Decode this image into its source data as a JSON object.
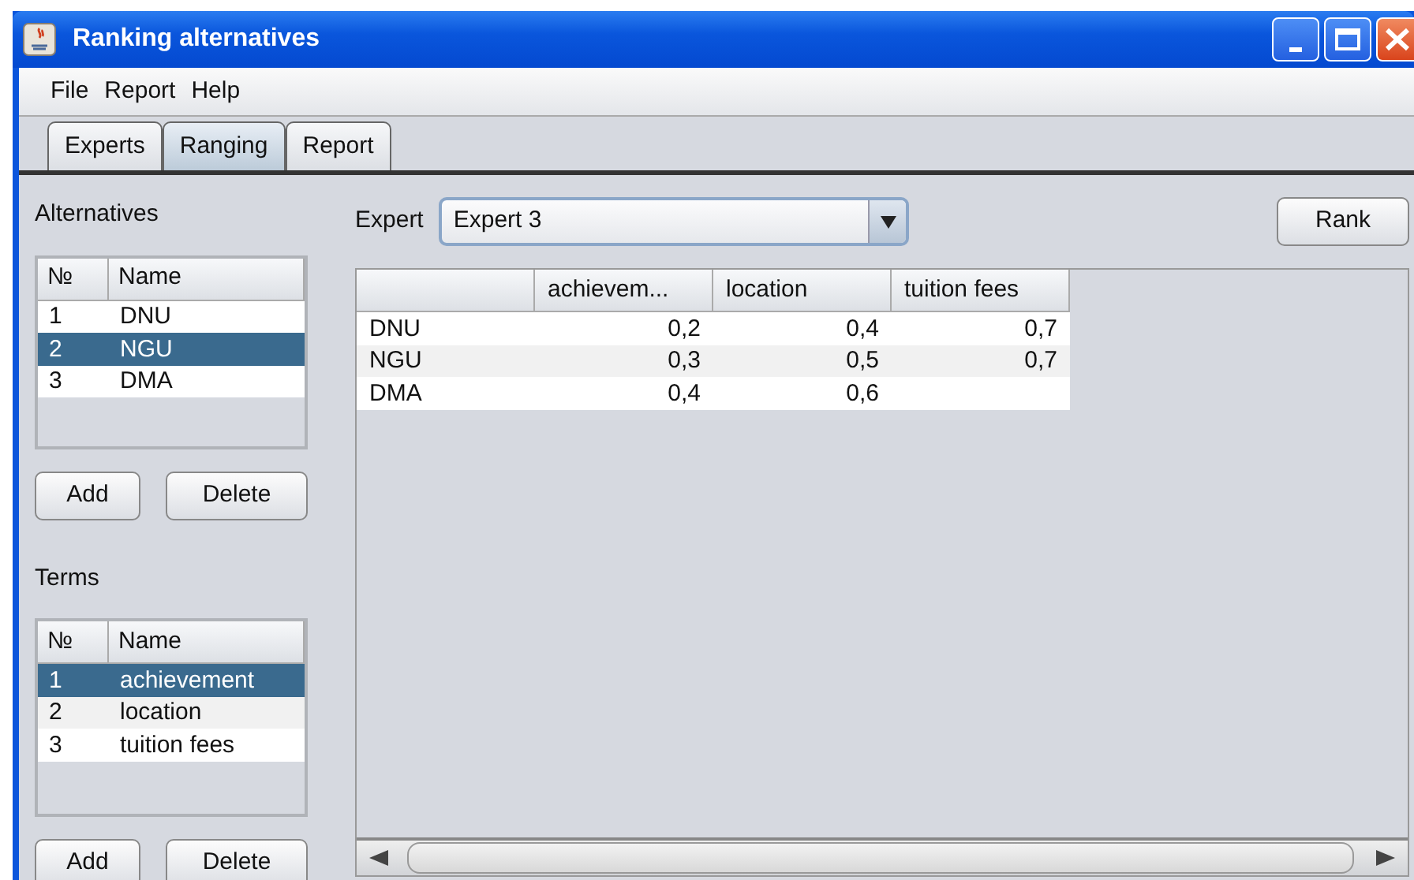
{
  "window": {
    "title": "Ranking alternatives"
  },
  "menu": [
    "File",
    "Report",
    "Help"
  ],
  "tabs": [
    {
      "label": "Experts",
      "selected": false
    },
    {
      "label": "Ranging",
      "selected": true
    },
    {
      "label": "Report",
      "selected": false
    }
  ],
  "alternatives": {
    "label": "Alternatives",
    "columns": [
      "№",
      "Name"
    ],
    "rows": [
      {
        "number": "1",
        "name": "DNU",
        "selected": false
      },
      {
        "number": "2",
        "name": "NGU",
        "selected": true
      },
      {
        "number": "3",
        "name": "DMA",
        "selected": false
      }
    ],
    "buttons": [
      "Add",
      "Delete"
    ]
  },
  "terms": {
    "label": "Terms",
    "columns": [
      "№",
      "Name"
    ],
    "rows": [
      {
        "number": "1",
        "name": "achievement",
        "selected": true
      },
      {
        "number": "2",
        "name": "location",
        "selected": false
      },
      {
        "number": "3",
        "name": "tuition fees",
        "selected": false
      }
    ],
    "buttons": [
      "Add",
      "Delete"
    ]
  },
  "expert": {
    "label": "Expert",
    "value": "Expert 3"
  },
  "rank_button": "Rank",
  "matrix": {
    "columns": [
      "achievem...",
      "location",
      "tuition fees"
    ],
    "rows": [
      {
        "name": "DNU",
        "values": [
          "0,2",
          "0,4",
          "0,7"
        ]
      },
      {
        "name": "NGU",
        "values": [
          "0,3",
          "0,5",
          "0,7"
        ]
      },
      {
        "name": "DMA",
        "values": [
          "0,4",
          "0,6"
        ]
      }
    ]
  }
}
